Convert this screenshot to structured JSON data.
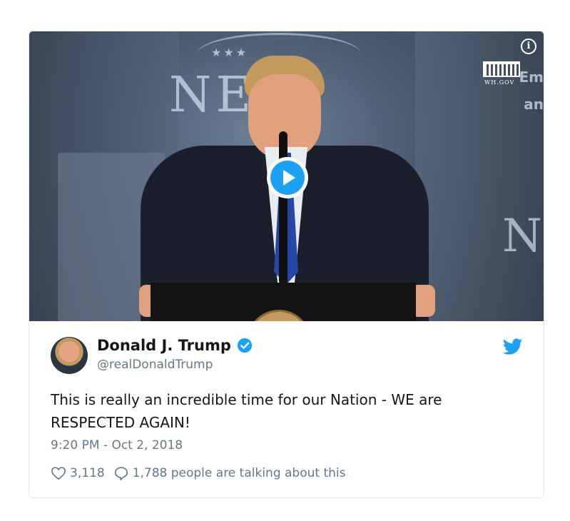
{
  "media": {
    "logo_text": "NEA",
    "banner_right_1": "Em",
    "banner_right_2": "an",
    "banner_right_3": "N",
    "source_logo_text": "WH.GOV",
    "info_icon": "info-icon",
    "play_icon": "play-icon"
  },
  "author": {
    "display_name": "Donald J. Trump",
    "handle": "@realDonaldTrump",
    "verified": true,
    "verified_icon": "verified-badge-icon",
    "avatar_icon": "avatar"
  },
  "tweet": {
    "text": "This is really an incredible time for our Nation - WE are RESPECTED AGAIN!",
    "timestamp": "9:20 PM - Oct 2, 2018"
  },
  "actions": {
    "like_count": "3,118",
    "reply_text": "1,788 people are talking about this"
  },
  "colors": {
    "accent": "#1da1f2",
    "text": "#14171a",
    "muted": "#657786",
    "border": "#e1e8ed"
  }
}
